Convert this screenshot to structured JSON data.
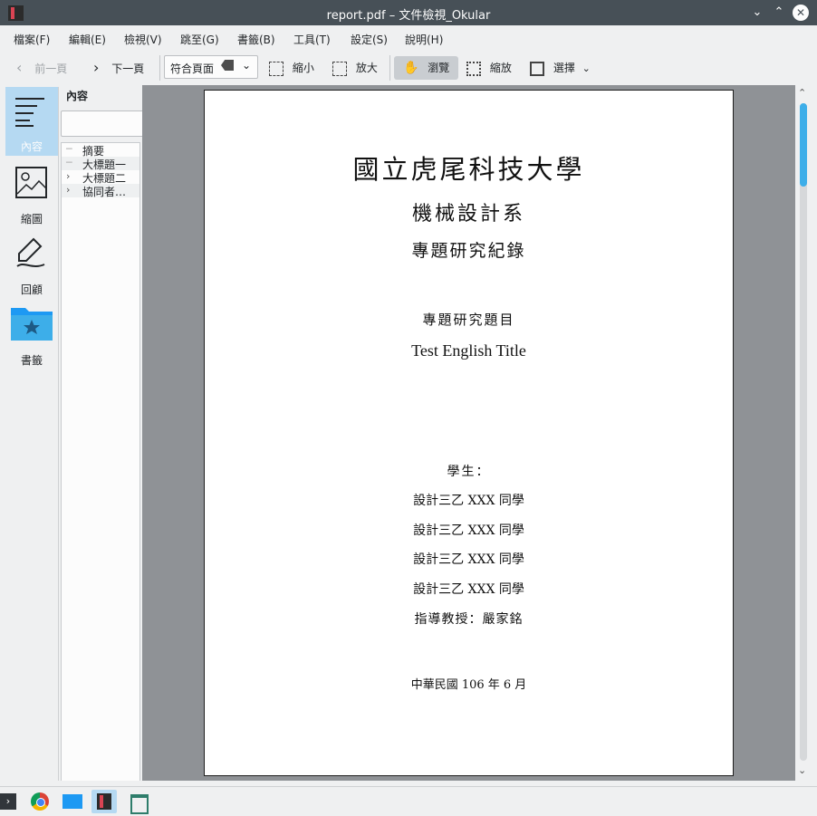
{
  "window": {
    "title": "report.pdf – 文件檢視_Okular"
  },
  "menu": [
    "檔案(F)",
    "編輯(E)",
    "檢視(V)",
    "跳至(G)",
    "書籤(B)",
    "工具(T)",
    "設定(S)",
    "說明(H)"
  ],
  "toolbar": {
    "prev_label": "前一頁",
    "next_label": "下一頁",
    "zoom_value": "符合頁面",
    "zoom_out_label": "縮小",
    "zoom_in_label": "放大",
    "browse_label": "瀏覽",
    "zoom_tool_label": "縮放",
    "select_label": "選擇"
  },
  "sidebar": {
    "items": [
      {
        "label": "內容",
        "icon": "contents-icon"
      },
      {
        "label": "縮圖",
        "icon": "thumbnails-icon"
      },
      {
        "label": "回顧",
        "icon": "review-icon"
      },
      {
        "label": "書籤",
        "icon": "bookmark-folder-icon"
      }
    ]
  },
  "toc": {
    "title": "內容",
    "search_value": "",
    "items": [
      {
        "label": "摘要",
        "expandable": false
      },
      {
        "label": "大標題一",
        "expandable": false
      },
      {
        "label": "大標題二",
        "expandable": true
      },
      {
        "label": "協同者…",
        "expandable": true
      }
    ]
  },
  "document": {
    "university": "國立虎尾科技大學",
    "department": "機械設計系",
    "record": "專題研究紀錄",
    "topic_label": "專題研究題目",
    "english_title": "Test English Title",
    "students_label": "學生：",
    "students": [
      "設計三乙 XXX 同學",
      "設計三乙 XXX 同學",
      "設計三乙 XXX 同學",
      "設計三乙 XXX 同學"
    ],
    "advisor": "指導教授：嚴家銘",
    "date": "中華民國 106 年 6 月"
  },
  "colors": {
    "accent": "#3daee9",
    "titlebar": "#475057",
    "viewer_bg": "#8f9296"
  }
}
